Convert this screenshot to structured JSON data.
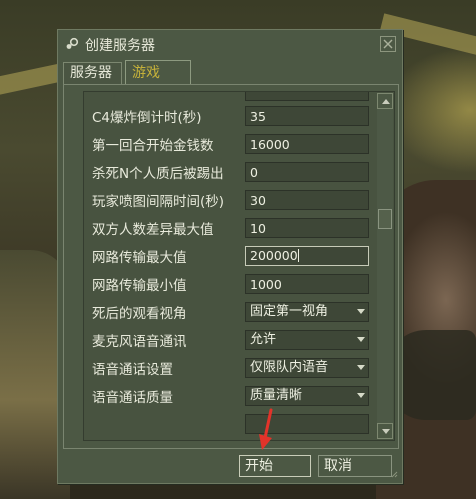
{
  "dialog": {
    "title": "创建服务器",
    "tabs": [
      {
        "label": "服务器",
        "active": false
      },
      {
        "label": "游戏",
        "active": true
      }
    ]
  },
  "settings": [
    {
      "label": "C4爆炸倒计时(秒)",
      "value": "35",
      "kind": "text"
    },
    {
      "label": "第一回合开始金钱数",
      "value": "16000",
      "kind": "text"
    },
    {
      "label": "杀死N个人质后被踢出",
      "value": "0",
      "kind": "text"
    },
    {
      "label": "玩家喷图间隔时间(秒)",
      "value": "30",
      "kind": "text"
    },
    {
      "label": "双方人数差异最大值",
      "value": "10",
      "kind": "text"
    },
    {
      "label": "网路传输最大值",
      "value": "200000",
      "kind": "text",
      "focused": true
    },
    {
      "label": "网路传输最小值",
      "value": "1000",
      "kind": "text"
    },
    {
      "label": "死后的观看视角",
      "value": "固定第一视角",
      "kind": "select"
    },
    {
      "label": "麦克风语音通讯",
      "value": "允许",
      "kind": "select"
    },
    {
      "label": "语音通话设置",
      "value": "仅限队内语音",
      "kind": "select"
    },
    {
      "label": "语音通话质量",
      "value": "质量清晰",
      "kind": "select"
    }
  ],
  "buttons": {
    "start": "开始",
    "cancel": "取消"
  },
  "colors": {
    "dialog_bg": "#4c5844",
    "active_tab_text": "#c6b23a",
    "annotation_arrow": "#e2332a"
  }
}
